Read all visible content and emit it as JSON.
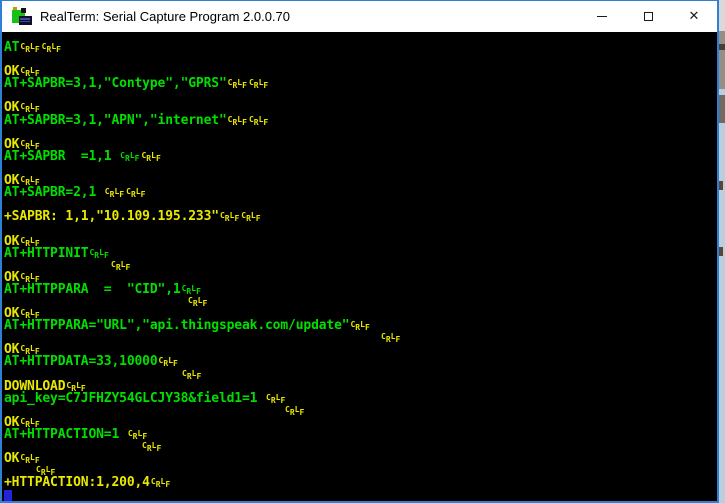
{
  "window": {
    "title": "RealTerm: Serial Capture Program 2.0.0.70",
    "controls": {
      "minimize": "minimize",
      "maximize": "maximize",
      "close": "close",
      "close_glyph": "✕"
    }
  },
  "colors": {
    "tx_green": "#00e000",
    "rx_yellow": "#e9e900",
    "terminal_bg": "#000000",
    "titlebar_bg": "#ffffff",
    "window_border": "#2f7fd5",
    "cursor_blue": "#2323dd"
  },
  "terminal": {
    "crlf_glyph": [
      "C",
      "R",
      "L",
      "F"
    ],
    "lines": [
      {
        "segs": [
          {
            "t": "AT",
            "c": "tx"
          },
          {
            "ctrl": 2,
            "c": "rx"
          }
        ]
      },
      {
        "segs": []
      },
      {
        "segs": [
          {
            "t": "OK",
            "c": "rx"
          },
          {
            "ctrl": 1,
            "c": "rx"
          }
        ]
      },
      {
        "segs": [
          {
            "t": "AT+SAPBR=3,1,\"Contype\",\"GPRS\"",
            "c": "tx"
          },
          {
            "ctrl": 2,
            "c": "rx"
          }
        ]
      },
      {
        "segs": []
      },
      {
        "segs": [
          {
            "t": "OK",
            "c": "rx"
          },
          {
            "ctrl": 1,
            "c": "rx"
          }
        ]
      },
      {
        "segs": [
          {
            "t": "AT+SAPBR=3,1,\"APN\",\"internet\"",
            "c": "tx"
          },
          {
            "ctrl": 2,
            "c": "rx"
          }
        ]
      },
      {
        "segs": []
      },
      {
        "segs": [
          {
            "t": "OK",
            "c": "rx"
          },
          {
            "ctrl": 1,
            "c": "rx"
          }
        ]
      },
      {
        "segs": [
          {
            "t": "AT+SAPBR  =1,1 ",
            "c": "tx"
          },
          {
            "ctrl": 1,
            "c": "tx"
          },
          {
            "ctrl": 1,
            "c": "rx"
          }
        ]
      },
      {
        "segs": []
      },
      {
        "segs": [
          {
            "t": "OK",
            "c": "rx"
          },
          {
            "ctrl": 1,
            "c": "rx"
          }
        ]
      },
      {
        "segs": [
          {
            "t": "AT+SAPBR=2,1 ",
            "c": "tx"
          },
          {
            "ctrl": 2,
            "c": "rx"
          }
        ]
      },
      {
        "segs": []
      },
      {
        "segs": [
          {
            "t": "+SAPBR: 1,1,\"10.109.195.233\"",
            "c": "rx"
          },
          {
            "ctrl": 2,
            "c": "rx"
          }
        ]
      },
      {
        "segs": []
      },
      {
        "segs": [
          {
            "t": "OK",
            "c": "rx"
          },
          {
            "ctrl": 1,
            "c": "rx"
          }
        ]
      },
      {
        "segs": [
          {
            "t": "AT+HTTPINIT",
            "c": "tx"
          },
          {
            "ctrl": 1,
            "c": "tx"
          }
        ]
      },
      {
        "indent": 106,
        "segs": [
          {
            "ctrl": 1,
            "c": "rx"
          }
        ]
      },
      {
        "segs": [
          {
            "t": "OK",
            "c": "rx"
          },
          {
            "ctrl": 1,
            "c": "rx"
          }
        ]
      },
      {
        "segs": [
          {
            "t": "AT+HTTPPARA  =  \"CID\",1",
            "c": "tx"
          },
          {
            "ctrl": 1,
            "c": "tx"
          }
        ]
      },
      {
        "indent": 183,
        "segs": [
          {
            "ctrl": 1,
            "c": "rx"
          }
        ]
      },
      {
        "segs": [
          {
            "t": "OK",
            "c": "rx"
          },
          {
            "ctrl": 1,
            "c": "rx"
          }
        ]
      },
      {
        "segs": [
          {
            "t": "AT+HTTPPARA=\"URL\",\"api.thingspeak.com/update\"",
            "c": "tx"
          },
          {
            "ctrl": 1,
            "c": "rx"
          }
        ]
      },
      {
        "indent": 376,
        "segs": [
          {
            "ctrl": 1,
            "c": "rx"
          }
        ]
      },
      {
        "segs": [
          {
            "t": "OK",
            "c": "rx"
          },
          {
            "ctrl": 1,
            "c": "rx"
          }
        ]
      },
      {
        "segs": [
          {
            "t": "AT+HTTPDATA=33,10000",
            "c": "tx"
          },
          {
            "ctrl": 1,
            "c": "rx"
          }
        ]
      },
      {
        "indent": 177,
        "segs": [
          {
            "ctrl": 1,
            "c": "rx"
          }
        ]
      },
      {
        "segs": [
          {
            "t": "DOWNLOAD",
            "c": "rx"
          },
          {
            "ctrl": 1,
            "c": "rx"
          }
        ]
      },
      {
        "segs": [
          {
            "t": "api_key=C7JFHZY54GLCJY38&field1=1 ",
            "c": "tx"
          },
          {
            "ctrl": 1,
            "c": "rx"
          }
        ]
      },
      {
        "indent": 280,
        "segs": [
          {
            "ctrl": 1,
            "c": "rx"
          }
        ]
      },
      {
        "segs": [
          {
            "t": "OK",
            "c": "rx"
          },
          {
            "ctrl": 1,
            "c": "rx"
          }
        ]
      },
      {
        "segs": [
          {
            "t": "AT+HTTPACTION=1 ",
            "c": "tx"
          },
          {
            "ctrl": 1,
            "c": "rx"
          }
        ]
      },
      {
        "indent": 137,
        "segs": [
          {
            "ctrl": 1,
            "c": "rx"
          }
        ]
      },
      {
        "segs": [
          {
            "t": "OK",
            "c": "rx"
          },
          {
            "ctrl": 1,
            "c": "rx"
          }
        ]
      },
      {
        "indent": 31,
        "segs": [
          {
            "ctrl": 1,
            "c": "rx"
          }
        ]
      },
      {
        "segs": [
          {
            "t": "+HTTPACTION:1,200,4",
            "c": "rx"
          },
          {
            "ctrl": 1,
            "c": "rx"
          }
        ]
      },
      {
        "cursor": true,
        "segs": []
      }
    ]
  }
}
